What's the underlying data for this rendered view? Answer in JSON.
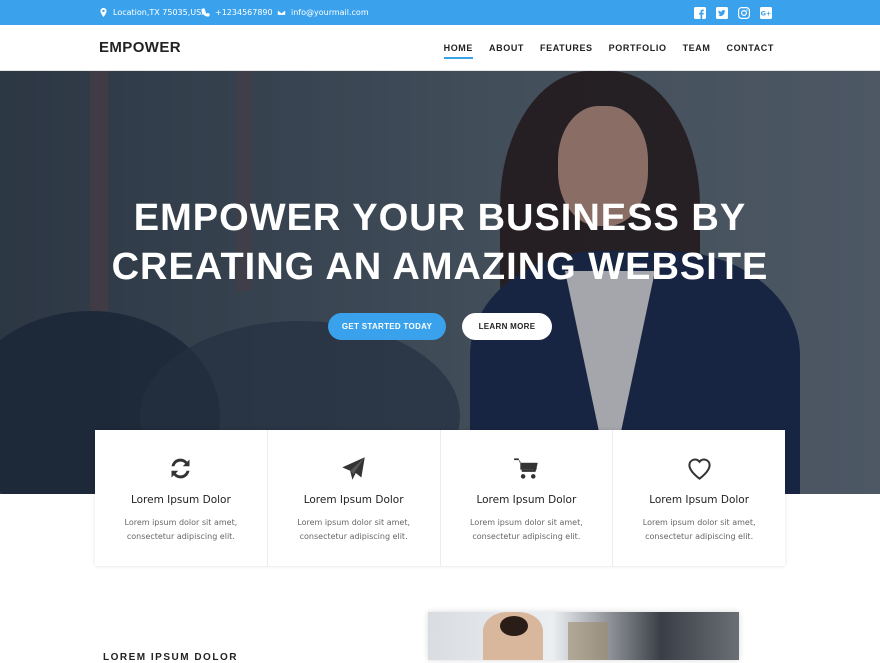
{
  "topbar": {
    "location": "Location,TX 75035,USA",
    "phone": "+1234567890",
    "email": "info@yourmail.com",
    "social": [
      {
        "icon": "facebook-icon",
        "glyph": "f"
      },
      {
        "icon": "twitter-icon",
        "glyph": "t"
      },
      {
        "icon": "instagram-icon",
        "glyph": "ig"
      },
      {
        "icon": "google-plus-icon",
        "glyph": "G+"
      }
    ]
  },
  "header": {
    "brand": "EMPOWER",
    "nav": [
      "HOME",
      "ABOUT",
      "FEATURES",
      "PORTFOLIO",
      "TEAM",
      "CONTACT"
    ],
    "active": "HOME"
  },
  "hero": {
    "headline_line1": "EMPOWER YOUR BUSINESS BY",
    "headline_line2": "CREATING AN AMAZING WEBSITE",
    "primary_button": "GET STARTED TODAY",
    "secondary_button": "LEARN MORE"
  },
  "features": [
    {
      "icon": "refresh-icon",
      "title": "Lorem Ipsum Dolor",
      "line1": "Lorem ipsum dolor sit amet,",
      "line2": "consectetur adipiscing elit."
    },
    {
      "icon": "paper-plane-icon",
      "title": "Lorem Ipsum Dolor",
      "line1": "Lorem ipsum dolor sit amet,",
      "line2": "consectetur adipiscing elit."
    },
    {
      "icon": "cart-icon",
      "title": "Lorem Ipsum Dolor",
      "line1": "Lorem ipsum dolor sit amet,",
      "line2": "consectetur adipiscing elit."
    },
    {
      "icon": "heart-icon",
      "title": "Lorem Ipsum Dolor",
      "line1": "Lorem ipsum dolor sit amet,",
      "line2": "consectetur adipiscing elit."
    }
  ],
  "section": {
    "title": "LOREM IPSUM DOLOR"
  },
  "colors": {
    "accent": "#3aa2ec",
    "dark_text": "#222222"
  }
}
